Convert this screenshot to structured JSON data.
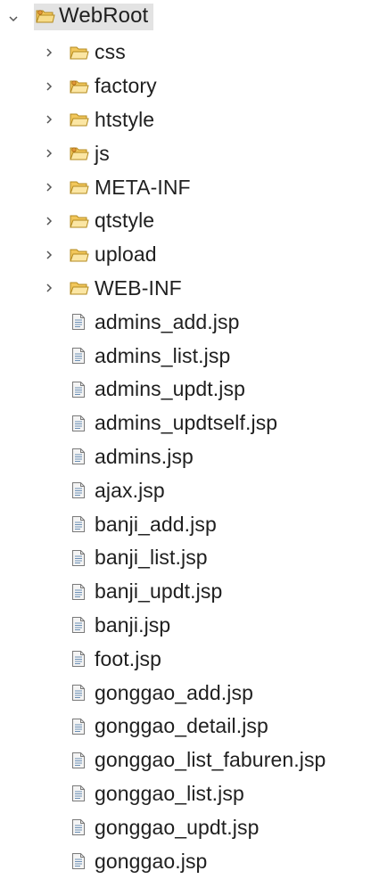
{
  "project": {
    "root": {
      "name": "WebRoot",
      "expanded": true,
      "icon": "project-folder-icon"
    },
    "folders": [
      {
        "name": "css",
        "icon": "folder-icon"
      },
      {
        "name": "factory",
        "icon": "source-folder-icon"
      },
      {
        "name": "htstyle",
        "icon": "folder-icon"
      },
      {
        "name": "js",
        "icon": "source-folder-icon"
      },
      {
        "name": "META-INF",
        "icon": "folder-icon"
      },
      {
        "name": "qtstyle",
        "icon": "folder-icon"
      },
      {
        "name": "upload",
        "icon": "folder-icon"
      },
      {
        "name": "WEB-INF",
        "icon": "folder-icon"
      }
    ],
    "files": [
      {
        "name": "admins_add.jsp",
        "icon": "jsp-file-icon"
      },
      {
        "name": "admins_list.jsp",
        "icon": "jsp-file-icon"
      },
      {
        "name": "admins_updt.jsp",
        "icon": "jsp-file-icon"
      },
      {
        "name": "admins_updtself.jsp",
        "icon": "jsp-file-icon"
      },
      {
        "name": "admins.jsp",
        "icon": "jsp-file-icon"
      },
      {
        "name": "ajax.jsp",
        "icon": "jsp-file-icon"
      },
      {
        "name": "banji_add.jsp",
        "icon": "jsp-file-icon"
      },
      {
        "name": "banji_list.jsp",
        "icon": "jsp-file-icon"
      },
      {
        "name": "banji_updt.jsp",
        "icon": "jsp-file-icon"
      },
      {
        "name": "banji.jsp",
        "icon": "jsp-file-icon"
      },
      {
        "name": "foot.jsp",
        "icon": "jsp-file-icon"
      },
      {
        "name": "gonggao_add.jsp",
        "icon": "jsp-file-icon"
      },
      {
        "name": "gonggao_detail.jsp",
        "icon": "jsp-file-icon"
      },
      {
        "name": "gonggao_list_faburen.jsp",
        "icon": "jsp-file-icon"
      },
      {
        "name": "gonggao_list.jsp",
        "icon": "jsp-file-icon"
      },
      {
        "name": "gonggao_updt.jsp",
        "icon": "jsp-file-icon"
      },
      {
        "name": "gonggao.jsp",
        "icon": "jsp-file-icon"
      }
    ]
  },
  "colors": {
    "folder_fill": "#f2c75c",
    "folder_stroke": "#b38a1e",
    "file_stroke": "#7a7a7a",
    "file_fill": "#f4f4f4",
    "chevron": "#555555",
    "selection": "#e3e3e3"
  }
}
